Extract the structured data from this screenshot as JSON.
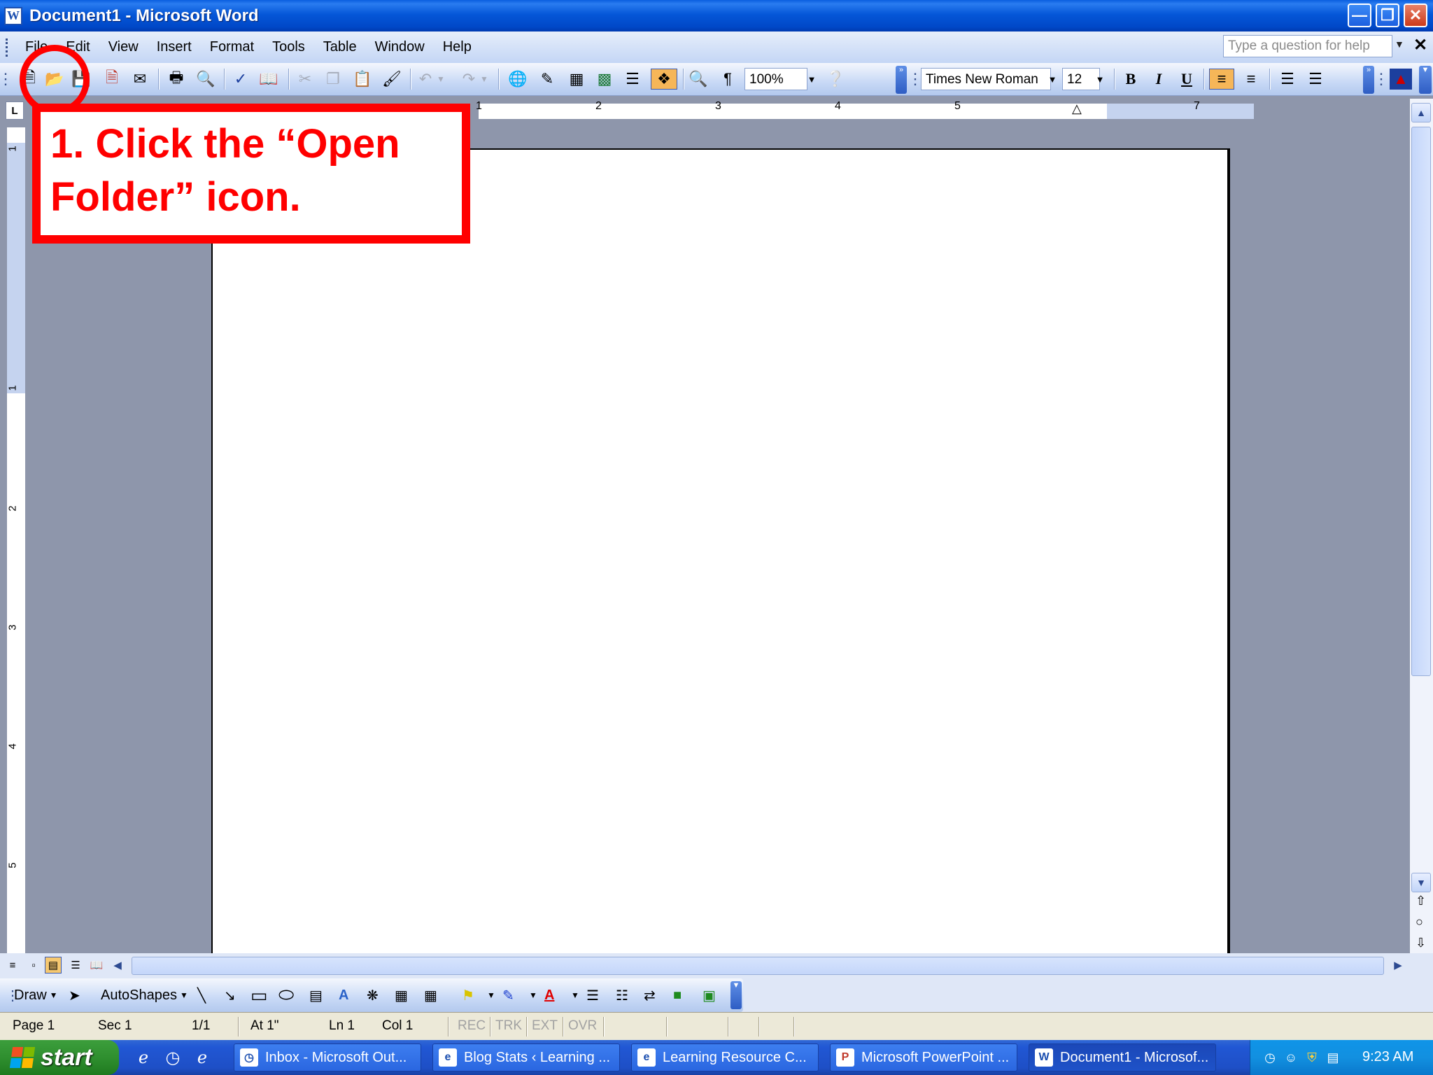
{
  "window": {
    "title": "Document1 - Microsoft Word",
    "app_icon": "word-icon"
  },
  "menu": {
    "items": [
      "File",
      "Edit",
      "View",
      "Insert",
      "Format",
      "Tools",
      "Table",
      "Window",
      "Help"
    ],
    "help_placeholder": "Type a question for help"
  },
  "toolbar": {
    "zoom": "100%",
    "font": "Times New Roman",
    "font_size": "12",
    "bold": "B",
    "italic": "I",
    "underline": "U",
    "pilcrow": "¶"
  },
  "ruler": {
    "h_numbers": [
      "1",
      "2",
      "3",
      "4",
      "5",
      "7"
    ],
    "v_numbers": [
      "1",
      "1",
      "2",
      "3",
      "4",
      "5"
    ]
  },
  "callout": {
    "text": "1. Click the “Open Folder” icon.",
    "color": "#ff0000"
  },
  "drawing": {
    "draw_label": "Draw",
    "autoshapes_label": "AutoShapes"
  },
  "status": {
    "page": "Page 1",
    "sec": "Sec 1",
    "pages": "1/1",
    "at": "At 1\"",
    "ln": "Ln 1",
    "col": "Col 1",
    "rec": "REC",
    "trk": "TRK",
    "ext": "EXT",
    "ovr": "OVR"
  },
  "taskbar": {
    "start_label": "start",
    "tasks": [
      {
        "label": "Inbox - Microsoft Out...",
        "icon": "outlook-icon"
      },
      {
        "label": "Blog Stats ‹ Learning ...",
        "icon": "ie-icon"
      },
      {
        "label": "Learning Resource C...",
        "icon": "ie-icon"
      },
      {
        "label": "Microsoft PowerPoint ...",
        "icon": "powerpoint-icon"
      },
      {
        "label": "Document1 - Microsof...",
        "icon": "word-icon",
        "active": true
      }
    ],
    "clock": "9:23 AM"
  }
}
